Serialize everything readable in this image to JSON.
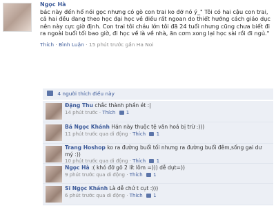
{
  "post": {
    "author": "Ngọc Hà",
    "text": "bác này đến hổ nói gọc nhưng có gò con trai ko đỡ nó ý_\" Tôi có hai cậu con trai, cả hai đều đang theo học đại học về điều rất ngoan do thiết hướng cách giáo dục nên này cực giờ định. Con trai tôi cháu lớn tôi đã 24 tuổi nhưng cũng chưa biết đi ra ngoài buổi tối bao giờ, đi học về là về nhà, ăn cơm xong lại học sài rồi đi ngủ.\"",
    "actions": {
      "like": "Thích",
      "comment": "Bình Luận",
      "time": "15 phút trước gần Ha Noi"
    }
  },
  "likes_bar": {
    "text": "4 người thích điều này"
  },
  "comments": [
    {
      "name": "Đặng Thu",
      "text": "chắc thành phần ét :|",
      "time": "14 phút trước",
      "likes": "1"
    },
    {
      "name": "Bá Ngọc Khánh",
      "text": "Hán này thuộc tệ văn hoá bị trừ :)))",
      "time": "11 phút trước qua di động",
      "likes": "1"
    },
    {
      "name": "Trang Hoshop",
      "text": "ko ra đường buổi tối nhưng ra đường buổi đêm,sống gai dư mý :))",
      "time": "10 phút trước qua di động",
      "likes": "1"
    },
    {
      "name": "Ngọc Hà",
      "text": ":( khó đỡ gõ 2 lít lôm =))) dễ dụt=))",
      "time": "9 phút trước qua di động",
      "likes": "1"
    },
    {
      "name": "Sĩ Ngọc Khánh",
      "text": "Là dễ chứ t cụt :)))",
      "time": "6 phút trước qua di động",
      "likes": "1"
    }
  ],
  "labels": {
    "like": "Thích",
    "sep": "·"
  }
}
